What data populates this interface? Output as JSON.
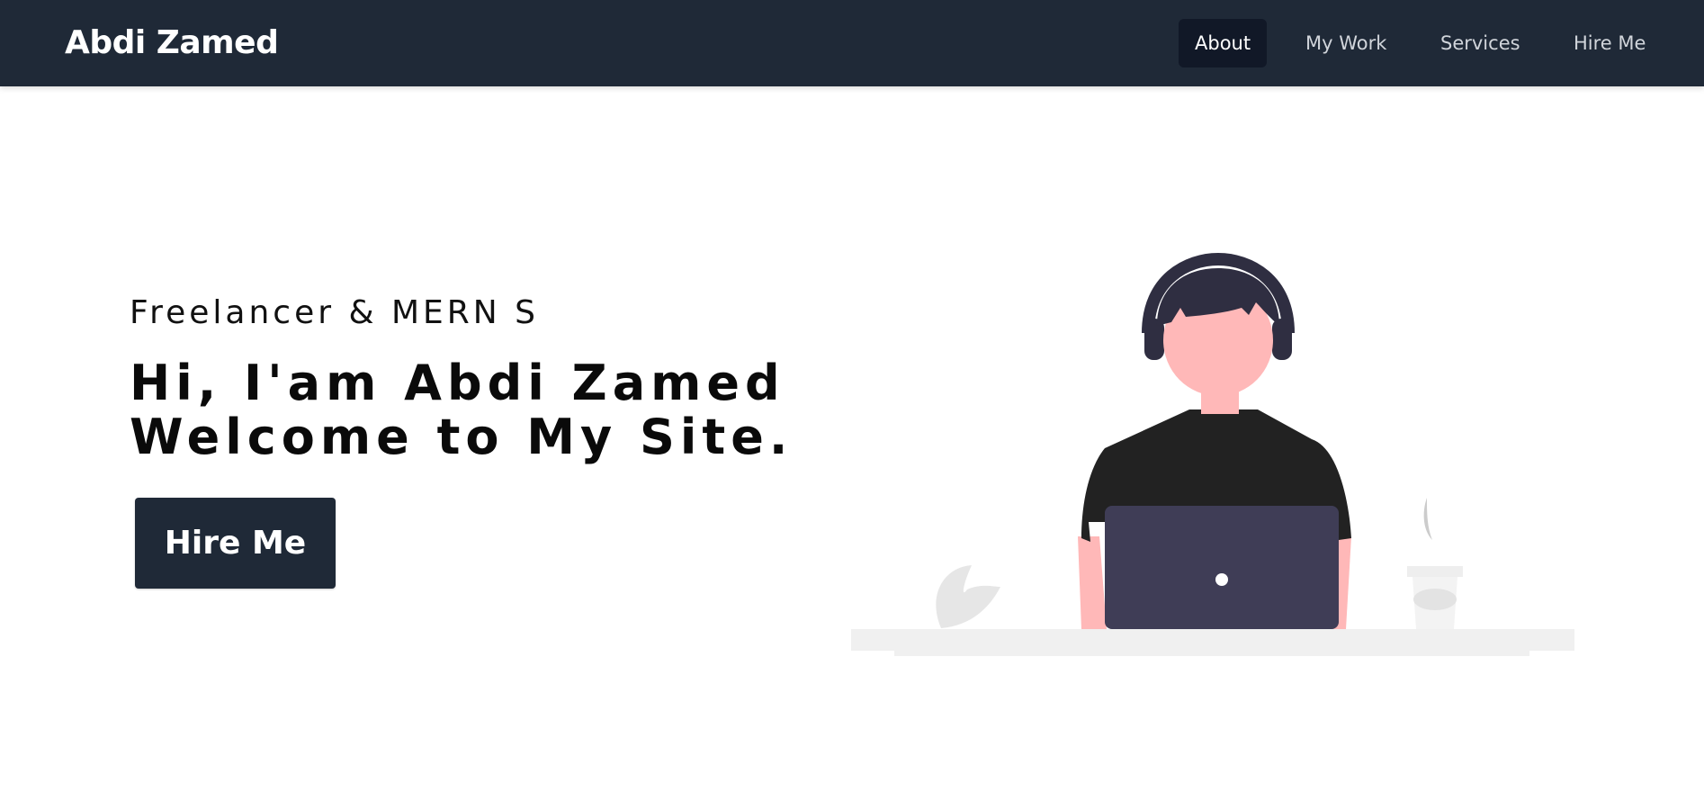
{
  "header": {
    "brand": "Abdi Zamed",
    "nav": [
      {
        "label": "About",
        "active": true
      },
      {
        "label": "My Work",
        "active": false
      },
      {
        "label": "Services",
        "active": false
      },
      {
        "label": "Hire Me",
        "active": false
      }
    ]
  },
  "hero": {
    "subtitle": "Freelancer & MERN S",
    "headline_line1": "Hi, I'am Abdi Zamed",
    "headline_line2": "Welcome to My Site.",
    "cta_label": "Hire Me"
  },
  "illustration": {
    "icon": "person-at-laptop-illustration",
    "colors": {
      "hair": "#2f2e41",
      "skin": "#ffb8b8",
      "shirt": "#222222",
      "laptop": "#3f3d56",
      "desk": "#f0f0f0",
      "plant": "#e6e6e6"
    }
  },
  "colors": {
    "nav_bg": "#1f2937",
    "nav_active_bg": "#111827",
    "nav_text": "#d1d5db",
    "button_bg": "#1f2937"
  }
}
